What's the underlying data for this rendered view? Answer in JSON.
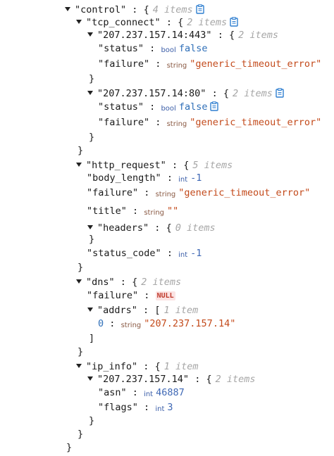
{
  "tree": {
    "control": {
      "key": "\"control\"",
      "count": "4 items"
    },
    "tcp_connect": {
      "key": "\"tcp_connect\"",
      "count": "2 items"
    },
    "tcp1": {
      "key": "\"207.237.157.14:443\"",
      "count": "2 items",
      "status_key": "\"status\"",
      "status_type": "bool",
      "status_value": "false",
      "failure_key": "\"failure\"",
      "failure_type": "string",
      "failure_value": "\"generic_timeout_error\""
    },
    "tcp2": {
      "key": "\"207.237.157.14:80\"",
      "count": "2 items",
      "status_key": "\"status\"",
      "status_type": "bool",
      "status_value": "false",
      "failure_key": "\"failure\"",
      "failure_type": "string",
      "failure_value": "\"generic_timeout_error\""
    },
    "http_request": {
      "key": "\"http_request\"",
      "count": "5 items",
      "body_length_key": "\"body_length\"",
      "body_length_type": "int",
      "body_length_value": "-1",
      "failure_key": "\"failure\"",
      "failure_type": "string",
      "failure_value": "\"generic_timeout_error\"",
      "title_key": "\"title\"",
      "title_type": "string",
      "title_value": "\"\"",
      "headers_key": "\"headers\"",
      "headers_count": "0 items",
      "status_code_key": "\"status_code\"",
      "status_code_type": "int",
      "status_code_value": "-1"
    },
    "dns": {
      "key": "\"dns\"",
      "count": "2 items",
      "failure_key": "\"failure\"",
      "failure_value": "NULL",
      "addrs_key": "\"addrs\"",
      "addrs_count": "1 item",
      "addr0_index": "0",
      "addr0_type": "string",
      "addr0_value": "\"207.237.157.14\""
    },
    "ip_info": {
      "key": "\"ip_info\"",
      "count": "1 item",
      "ip_key": "\"207.237.157.14\"",
      "ip_count": "2 items",
      "asn_key": "\"asn\"",
      "asn_type": "int",
      "asn_value": "46887",
      "flags_key": "\"flags\"",
      "flags_type": "int",
      "flags_value": "3"
    }
  },
  "punctuation": {
    "colon": ":",
    "open_obj": "{",
    "close_obj": "}",
    "open_arr": "[",
    "close_arr": "]"
  },
  "icons": {
    "copy": "clipboard-icon",
    "toggle": "caret-down-icon"
  },
  "colors": {
    "string": "#c34a1b",
    "bool": "#2f6fb8",
    "number": "#3f68b5",
    "count": "#a6a6a6",
    "null_bg": "#fbe3e3",
    "null_fg": "#c0392b",
    "copy_icon": "#2f7fd0"
  }
}
